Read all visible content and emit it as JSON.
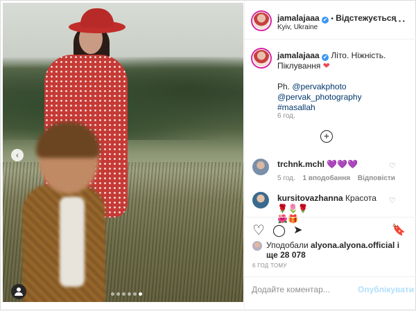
{
  "post": {
    "carousel": {
      "prev_icon": "‹",
      "slide_count": 6,
      "active_slide": 5
    }
  },
  "header": {
    "username": "jamalajaaa",
    "verified_icon": "✔",
    "separator": "•",
    "follow_label": "Відстежується",
    "location": "Kyiv, Ukraine",
    "more_icon": "···"
  },
  "caption": {
    "username": "jamalajaaa",
    "text": "Літо. Ніжність. Піклування",
    "heart": "❤",
    "ph_label": "Ph.",
    "mention1": "@pervakphoto",
    "mention2": "@pervak_photography",
    "hashtag": "#masallah",
    "time": "6 год."
  },
  "comments": [
    {
      "username": "trchnk.mchl",
      "text": "💜💜💜",
      "time": "5 год.",
      "likes": "1 вподобання",
      "reply": "Відповісти"
    },
    {
      "username": "kursitovazhanna",
      "text": "Красота 🌹🌷🌹",
      "line2": "🌺🎁"
    }
  ],
  "load_more_icon": "+",
  "actions": {
    "like_icon": "♡",
    "comment_icon": "◯",
    "share_icon": "➤",
    "save_icon": "🔖"
  },
  "likes": {
    "prefix": "Уподобали",
    "user": "alyona.alyona.official",
    "suffix": "і ще 28 078"
  },
  "post_time": "6 ГОД ТОМУ",
  "add_comment": {
    "placeholder": "Додайте коментар...",
    "publish_label": "Опублікувати"
  },
  "colors": {
    "accent": "#3897f0",
    "link": "#00376b",
    "muted": "#8e8e8e",
    "dress_red": "#c63a36",
    "heart_purple": "#8a4cd6"
  }
}
